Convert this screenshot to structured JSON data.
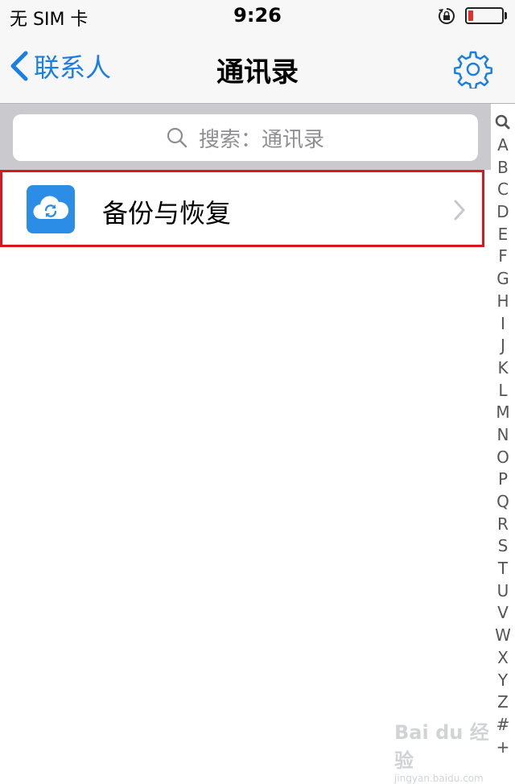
{
  "status_bar": {
    "carrier": "无 SIM 卡",
    "time": "9:26",
    "battery_level": 0.15,
    "battery_color": "#e0302b"
  },
  "nav": {
    "back_label": "联系人",
    "title": "通讯录",
    "settings_icon": "gear-icon"
  },
  "search": {
    "placeholder": "搜索：通讯录"
  },
  "list": {
    "items": [
      {
        "label": "备份与恢复",
        "icon": "cloud-sync-icon"
      }
    ]
  },
  "section_index": [
    "A",
    "B",
    "C",
    "D",
    "E",
    "F",
    "G",
    "H",
    "I",
    "J",
    "K",
    "L",
    "M",
    "N",
    "O",
    "P",
    "Q",
    "R",
    "S",
    "T",
    "U",
    "V",
    "W",
    "X",
    "Y",
    "Z",
    "#",
    "+"
  ],
  "watermark": {
    "logo": "Bai du 经验",
    "url": "jingyan.baidu.com"
  },
  "colors": {
    "accent": "#1a7fe4",
    "highlight_border": "#d7191f",
    "icon_bg": "#2b8de6"
  }
}
